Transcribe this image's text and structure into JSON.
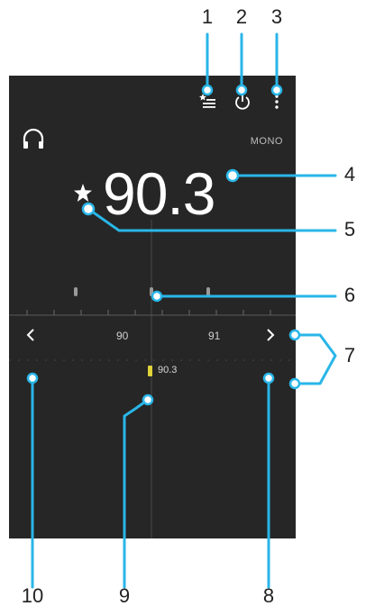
{
  "app": {
    "audio_mode": "MONO",
    "frequency": "90.3",
    "dial": {
      "ticks": [
        "90",
        "91"
      ],
      "station_marker_label": "90.3"
    },
    "icons": {
      "top_left": "headphones-icon",
      "top_right": [
        "favourites-list-icon",
        "power-icon",
        "more-options-icon"
      ],
      "favourite": "star-icon",
      "prev": "chevron-left-icon",
      "next": "chevron-right-icon"
    }
  },
  "callouts": [
    "1",
    "2",
    "3",
    "4",
    "5",
    "6",
    "7",
    "8",
    "9",
    "10"
  ],
  "colors": {
    "screen_bg": "#262626",
    "callout_line": "#29b6e8",
    "text_primary": "#ffffff",
    "text_secondary": "#bdbdbd",
    "accent_marker": "#e0d33a"
  }
}
